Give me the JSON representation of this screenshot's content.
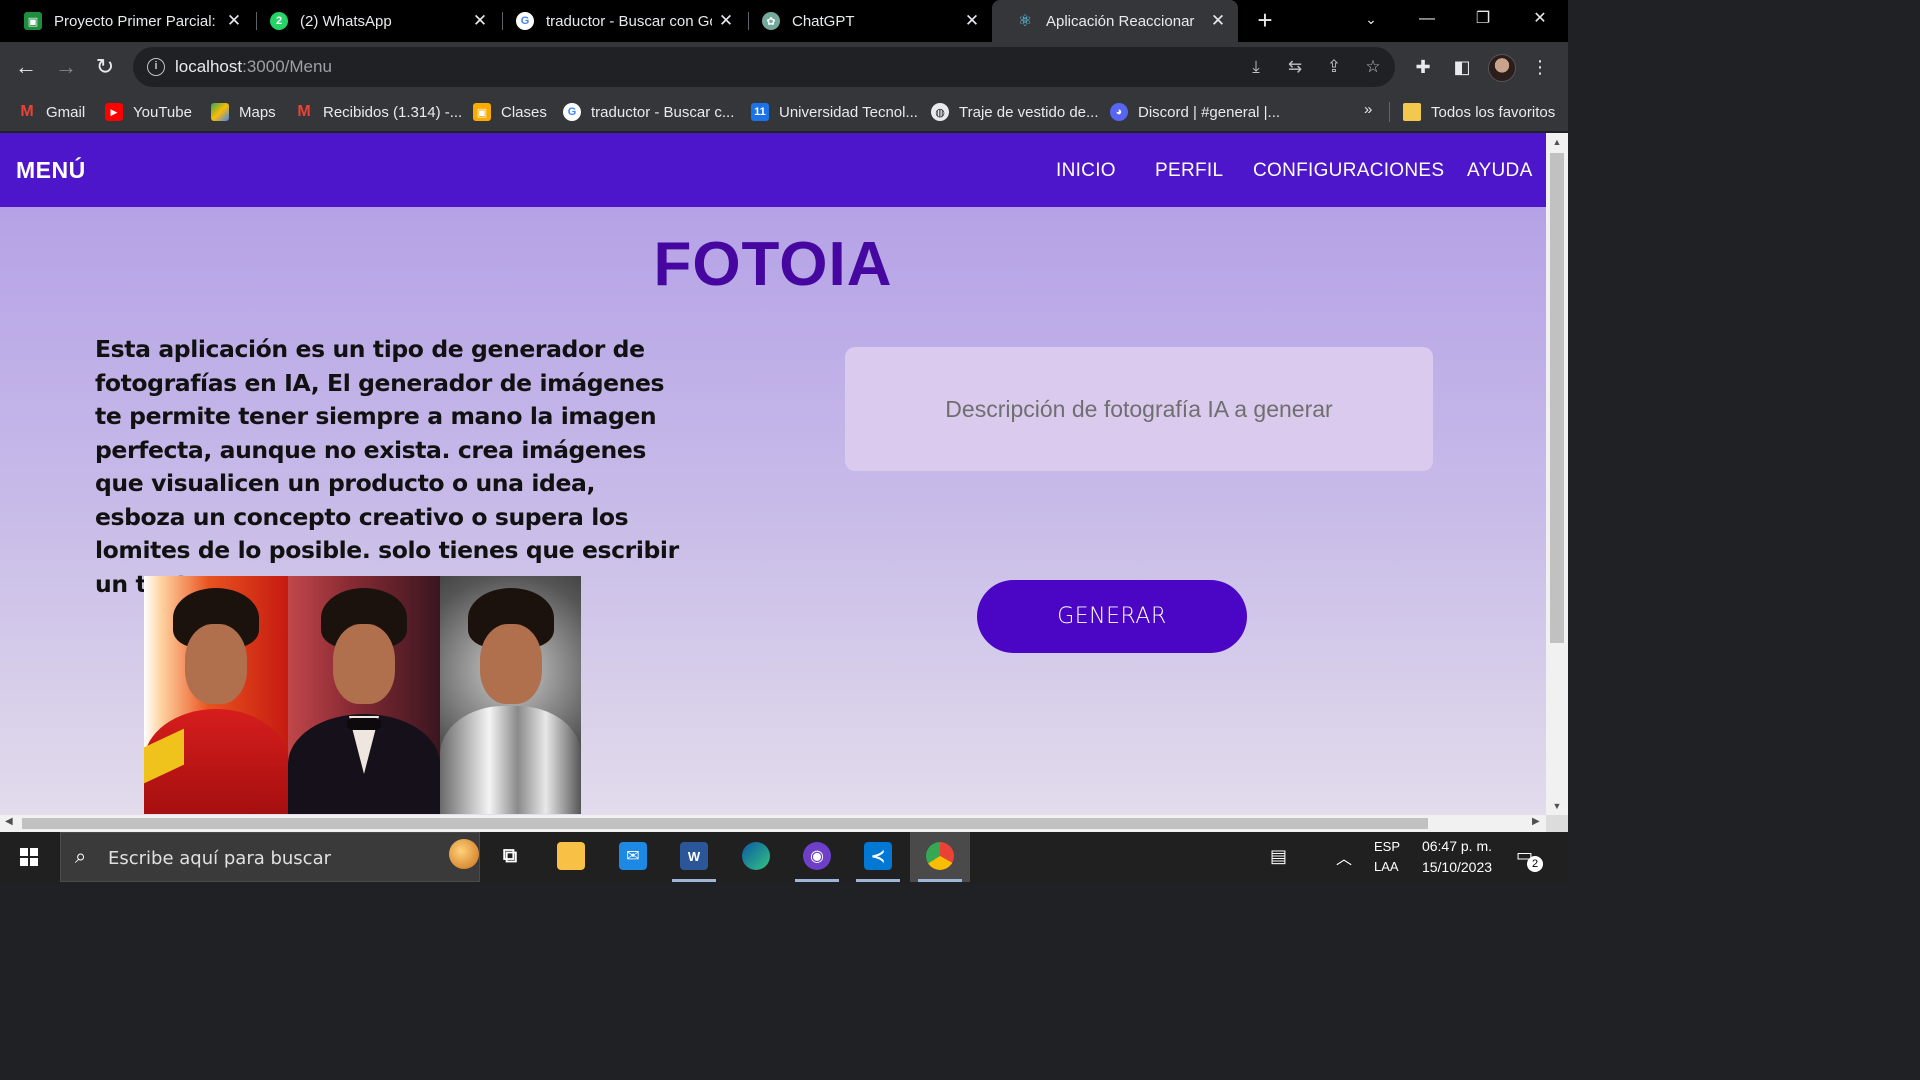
{
  "browser": {
    "tabs": [
      {
        "title": "Proyecto Primer Parcial: /",
        "icon": "classroom-icon",
        "color": "#1e8e3e"
      },
      {
        "title": "(2) WhatsApp",
        "icon": "whatsapp-icon",
        "color": "#25d366"
      },
      {
        "title": "traductor - Buscar con Go",
        "icon": "google-icon",
        "color": "#ffffff"
      },
      {
        "title": "ChatGPT",
        "icon": "chatgpt-icon",
        "color": "#74aa9c"
      },
      {
        "title": "Aplicación Reaccionar",
        "icon": "react-icon",
        "color": "#61dafb"
      }
    ],
    "url": {
      "host": "localhost",
      "rest": ":3000/Menu"
    },
    "bookmarks": [
      {
        "label": "Gmail",
        "icon": "gmail-icon"
      },
      {
        "label": "YouTube",
        "icon": "youtube-icon"
      },
      {
        "label": "Maps",
        "icon": "maps-icon"
      },
      {
        "label": "Recibidos (1.314) -...",
        "icon": "gmail-icon"
      },
      {
        "label": "Clases",
        "icon": "classroom-icon"
      },
      {
        "label": "traductor - Buscar c...",
        "icon": "google-icon"
      },
      {
        "label": "Universidad Tecnol...",
        "icon": "calendar-icon"
      },
      {
        "label": "Traje de vestido de...",
        "icon": "globe-icon"
      },
      {
        "label": "Discord | #general |...",
        "icon": "discord-icon"
      }
    ],
    "bookmarks_more": "»",
    "all_bookmarks": "Todos los favoritos"
  },
  "app": {
    "brand": "MENÚ",
    "nav": [
      "INICIO",
      "PERFIL",
      "CONFIGURACIONES",
      "AYUDA"
    ],
    "title": "FOTOIA",
    "description": "Esta aplicación es un tipo de generador de fotografías en IA, El generador de imágenes te permite tener siempre a mano la imagen perfecta, aunque no exista. crea imágenes que visualicen un producto o una idea, esboza un concepto creativo o supera los lomites de lo posible. solo tienes que escribir un texto.",
    "prompt_placeholder": "Descripción de fotografía IA a generar",
    "generate_label": "GENERAR",
    "colors": {
      "nav": "#4e16ca",
      "title": "#45079f",
      "button": "#4a06c4"
    }
  },
  "taskbar": {
    "search_placeholder": "Escribe aquí para buscar",
    "lang_top": "ESP",
    "lang_bottom": "LAA",
    "time": "06:47 p. m.",
    "date": "15/10/2023",
    "notifications": "2"
  }
}
